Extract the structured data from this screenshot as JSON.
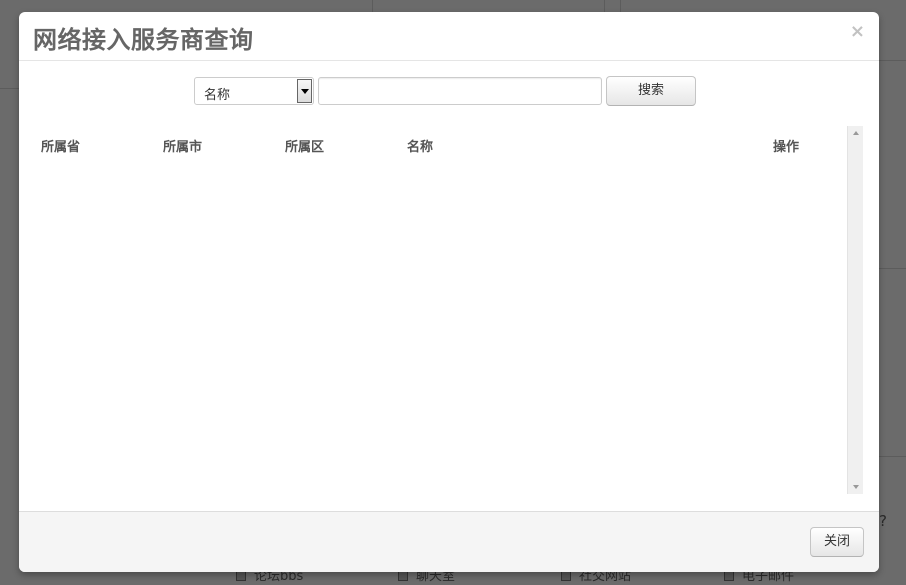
{
  "dialog": {
    "title": "网络接入服务商查询",
    "close_glyph": "×"
  },
  "search": {
    "field_selected": "名称",
    "input_value": "",
    "input_placeholder": "",
    "button_label": "搜索"
  },
  "table": {
    "columns": [
      "所属省",
      "所属市",
      "所属区",
      "名称",
      "操作"
    ],
    "rows": []
  },
  "footer": {
    "close_label": "关闭"
  },
  "background": {
    "checkbox_labels": [
      "论坛bbs",
      "聊天室",
      "社交网站",
      "电子邮件"
    ],
    "question_mark": "?"
  }
}
